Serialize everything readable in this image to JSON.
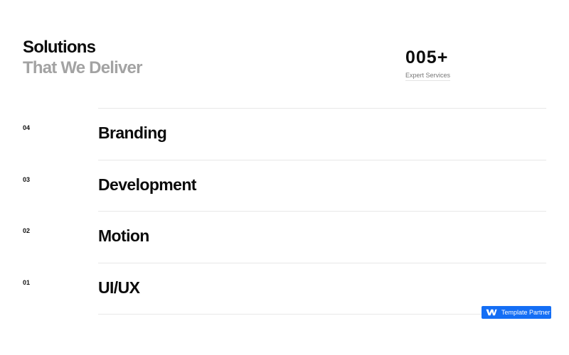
{
  "heading": {
    "line1": "Solutions",
    "line2": "That We Deliver"
  },
  "stat": {
    "number": "005+",
    "label": "Expert Services"
  },
  "services": [
    {
      "number": "04",
      "title": "Branding"
    },
    {
      "number": "03",
      "title": "Development"
    },
    {
      "number": "02",
      "title": "Motion"
    },
    {
      "number": "01",
      "title": "UI/UX"
    }
  ],
  "badge": {
    "icon": "webflow-logo-icon",
    "label": "Template Partner"
  },
  "colors": {
    "text": "#0c0c0c",
    "muted_heading": "#a3a3a3",
    "divider": "#e7e7e7",
    "badge_background": "#146ef5",
    "badge_text": "#ffffff"
  }
}
